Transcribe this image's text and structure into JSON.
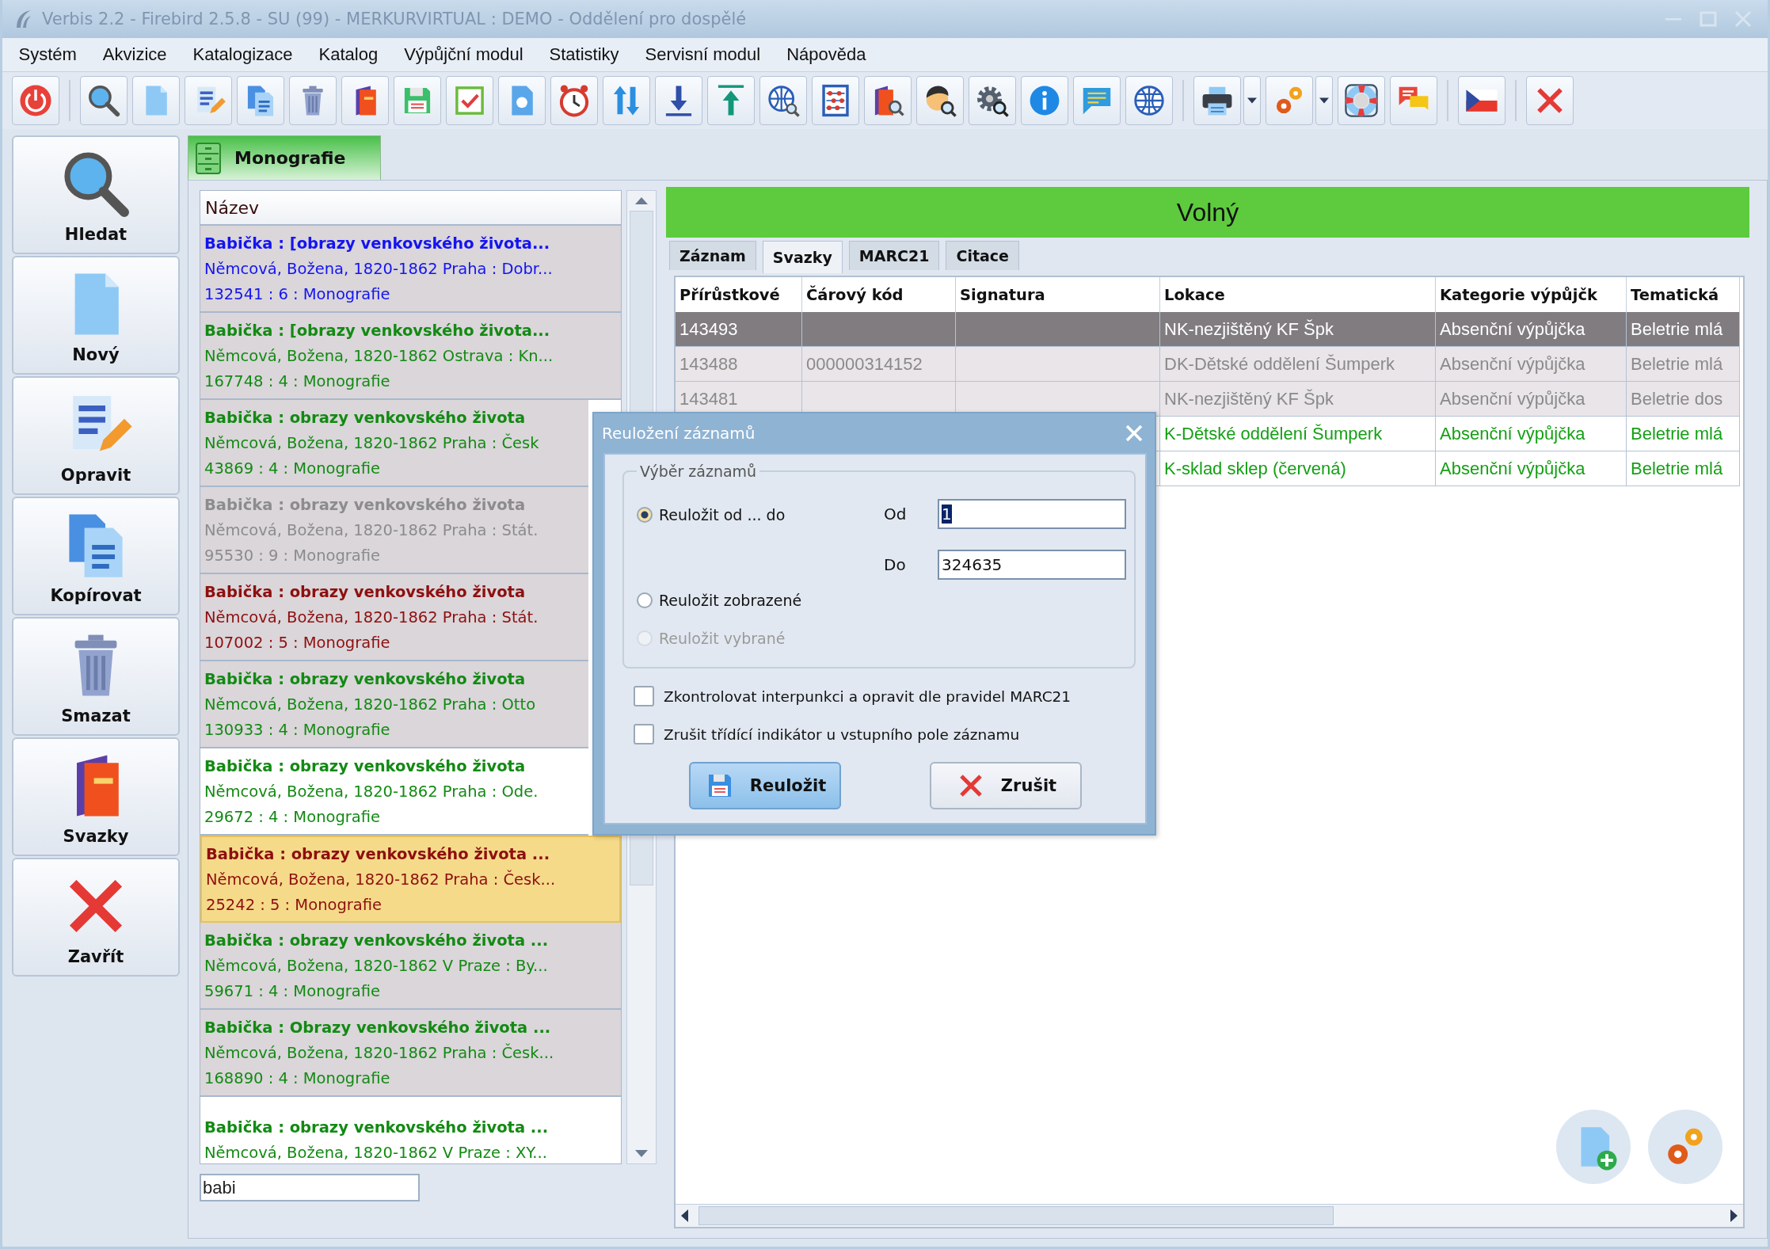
{
  "window": {
    "title": "Verbis 2.2 - Firebird 2.5.8 - SU (99) - MERKURVIRTUAL : DEMO - Oddělení pro dospělé"
  },
  "menu": [
    "Systém",
    "Akvizice",
    "Katalogizace",
    "Katalog",
    "Výpůjční modul",
    "Statistiky",
    "Servisní modul",
    "Nápověda"
  ],
  "sidebar": {
    "items": [
      {
        "label": "Hledat"
      },
      {
        "label": "Nový"
      },
      {
        "label": "Opravit"
      },
      {
        "label": "Kopírovat"
      },
      {
        "label": "Smazat"
      },
      {
        "label": "Svazky"
      },
      {
        "label": "Zavřít"
      }
    ]
  },
  "document_tab": {
    "label": "Monografie"
  },
  "records": {
    "header": "Název",
    "items": [
      {
        "title": "Babička : [obrazy venkovského života...",
        "author": "Němcová, Božena, 1820-1862 Praha : Dobr...",
        "info": "132541 : 6 : Monografie",
        "color": "#1414f0",
        "shaded": true,
        "selected": false
      },
      {
        "title": "Babička : [obrazy venkovského života...",
        "author": "Němcová, Božena, 1820-1862 Ostrava : Kn...",
        "info": "167748 : 4 : Monografie",
        "color": "#138a13",
        "shaded": true,
        "selected": false
      },
      {
        "title": "Babička : obrazy venkovského života",
        "author": "Němcová, Božena, 1820-1862 Praha : Česk",
        "info": "43869 : 4 : Monografie",
        "color": "#138a13",
        "shaded": true,
        "selected": false
      },
      {
        "title": "Babička : obrazy venkovského života",
        "author": "Němcová, Božena, 1820-1862 Praha : Stát.",
        "info": "95530 : 9 : Monografie",
        "color": "#8c8c8c",
        "shaded": true,
        "selected": false
      },
      {
        "title": "Babička : obrazy venkovského života",
        "author": "Němcová, Božena, 1820-1862 Praha : Stát.",
        "info": "107002 : 5 : Monografie",
        "color": "#8e0f0f",
        "shaded": true,
        "selected": false
      },
      {
        "title": "Babička : obrazy venkovského života",
        "author": "Němcová, Božena, 1820-1862 Praha : Otto",
        "info": "130933 : 4 : Monografie",
        "color": "#138a13",
        "shaded": true,
        "selected": false
      },
      {
        "title": "Babička : obrazy venkovského života",
        "author": "Němcová, Božena, 1820-1862 Praha : Ode.",
        "info": "29672 : 4 : Monografie",
        "color": "#138a13",
        "shaded": false,
        "selected": false
      },
      {
        "title": "Babička : obrazy venkovského života ...",
        "author": "Němcová, Božena, 1820-1862 Praha : Česk...",
        "info": "25242 : 5 : Monografie",
        "color": "#8e0f0f",
        "selected": true
      },
      {
        "title": "Babička : obrazy venkovského života ...",
        "author": "Němcová, Božena, 1820-1862 V Praze : By...",
        "info": "59671 : 4 : Monografie",
        "color": "#138a13",
        "shaded": true,
        "selected": false
      },
      {
        "title": "Babička : Obrazy venkovského života ...",
        "author": "Němcová, Božena, 1820-1862 Praha : Česk...",
        "info": "168890 : 4 : Monografie",
        "color": "#138a13",
        "shaded": true,
        "selected": false
      },
      {
        "title": "Babička : obrazy venkovského života ...",
        "author": "Němcová, Božena, 1820-1862 V Praze : XY...",
        "color": "#138a13",
        "shaded": false,
        "selected": false
      }
    ],
    "search": {
      "value": "babi"
    }
  },
  "status": {
    "label": "Volný"
  },
  "tabs": [
    {
      "label": "Záznam",
      "selected": false
    },
    {
      "label": "Svazky",
      "selected": true
    },
    {
      "label": "MARC21",
      "selected": false
    },
    {
      "label": "Citace",
      "selected": false
    }
  ],
  "volumes": {
    "columns": [
      "Přírůstkové",
      "Čárový kód",
      "Signatura",
      "Lokace",
      "Kategorie výpůjčk",
      "Tematická"
    ],
    "rows": [
      {
        "cells": [
          "143493",
          null,
          null,
          "NK-nezjištěný KF Špk",
          "Absenční výpůjčka",
          "Beletrie mlá"
        ],
        "color": "#ffffff",
        "selected": true
      },
      {
        "cells": [
          "143488",
          "000000314152",
          null,
          "DK-Dětské oddělení Šumperk",
          "Absenční výpůjčka",
          "Beletrie mlá"
        ],
        "color": "#8a8a8a",
        "shaded": true,
        "selected": false
      },
      {
        "cells": [
          "143481",
          null,
          null,
          "NK-nezjištěný KF Špk",
          "Absenční výpůjčka",
          "Beletrie dos"
        ],
        "color": "#8a8a8a",
        "shaded": true,
        "selected": false
      },
      {
        "cells": [
          null,
          null,
          null,
          "K-Dětské oddělení Šumperk",
          "Absenční výpůjčka",
          "Beletrie mlá"
        ],
        "color": "#15a015",
        "shaded": false,
        "selected": false
      },
      {
        "cells": [
          null,
          null,
          null,
          "K-sklad sklep (červená)",
          "Absenční výpůjčka",
          "Beletrie mlá"
        ],
        "color": "#15a015",
        "shaded": false,
        "selected": false
      }
    ]
  },
  "dialog": {
    "title": "Reuložení záznamů",
    "group": {
      "title": "Výběr záznamů",
      "options": [
        {
          "label": "Reuložit od ... do",
          "selected": true,
          "disabled": false
        },
        {
          "label": "Reuložit zobrazené",
          "selected": false,
          "disabled": false
        },
        {
          "label": "Reuložit vybrané",
          "selected": false,
          "disabled": true
        }
      ],
      "fields": [
        {
          "label": "Od",
          "value": "1",
          "text_selected": true
        },
        {
          "label": "Do",
          "value": "324635",
          "text_selected": false
        }
      ]
    },
    "checks": [
      {
        "label": "Zkontrolovat interpunkci a opravit dle pravidel MARC21",
        "checked": false
      },
      {
        "label": "Zrušit třídící indikátor u vstupního pole záznamu",
        "checked": false
      }
    ],
    "buttons": [
      {
        "label": "Reuložit",
        "default": true
      },
      {
        "label": "Zrušit",
        "default": false
      }
    ]
  }
}
